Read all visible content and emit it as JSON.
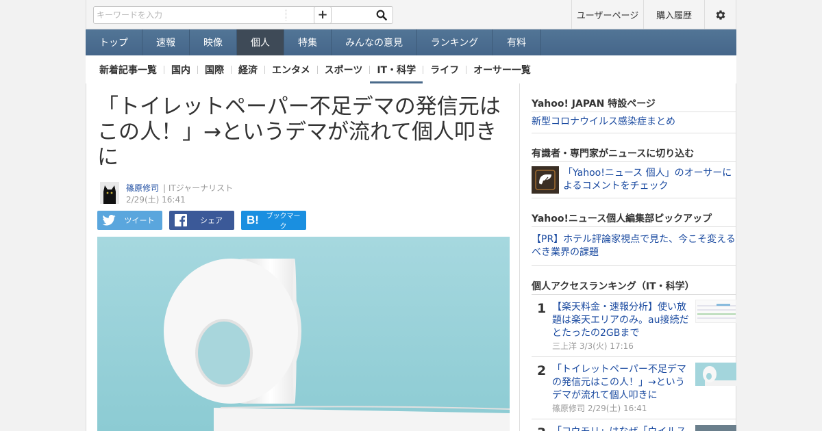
{
  "search": {
    "placeholder": "キーワードを入力",
    "value": ""
  },
  "header": {
    "user_page": "ユーザーページ",
    "purchase_history": "購入履歴"
  },
  "nav": [
    "トップ",
    "速報",
    "映像",
    "個人",
    "特集",
    "みんなの意見",
    "ランキング",
    "有料"
  ],
  "nav_active": "個人",
  "subnav": [
    "新着記事一覧",
    "国内",
    "国際",
    "経済",
    "エンタメ",
    "スポーツ",
    "IT・科学",
    "ライフ",
    "オーサー一覧"
  ],
  "subnav_active": "IT・科学",
  "article": {
    "title": "「トイレットペーパー不足デマの発信元はこの人！」→というデマが流れて個人叩きに",
    "author_name": "篠原修司",
    "author_title": "| ITジャーナリスト",
    "date": "2/29(土) 16:41",
    "share_twitter": "ツイート",
    "share_facebook": "シェア",
    "share_hatena": "ブックマーク"
  },
  "sidebar": {
    "special_title": "Yahoo! JAPAN 特設ページ",
    "special_link": "新型コロナウイルス感染症まとめ",
    "experts_title": "有識者・専門家がニュースに切り込む",
    "experts_link": "「Yahoo!ニュース 個人」のオーサーによるコメントをチェック",
    "pickup_title": "Yahoo!ニュース個人編集部ピックアップ",
    "pickup_link": "【PR】ホテル評論家視点で見た、今こそ変えるべき業界の課題",
    "ranking_title": "個人アクセスランキング（IT・科学）",
    "ranking": [
      {
        "rank": "1",
        "title": "【楽天料金・速報分析】使い放題は楽天エリアのみ。au接続だとたったの2GBまで",
        "meta": "三上洋  3/3(火) 17:16"
      },
      {
        "rank": "2",
        "title": "「トイレットペーパー不足デマの発信元はこの人！」→というデマが流れて個人叩きに",
        "meta": "篠原修司  2/29(土) 16:41"
      },
      {
        "rank": "3",
        "title": "「コウモリ」はなぜ「ウイルス",
        "meta": ""
      }
    ]
  }
}
